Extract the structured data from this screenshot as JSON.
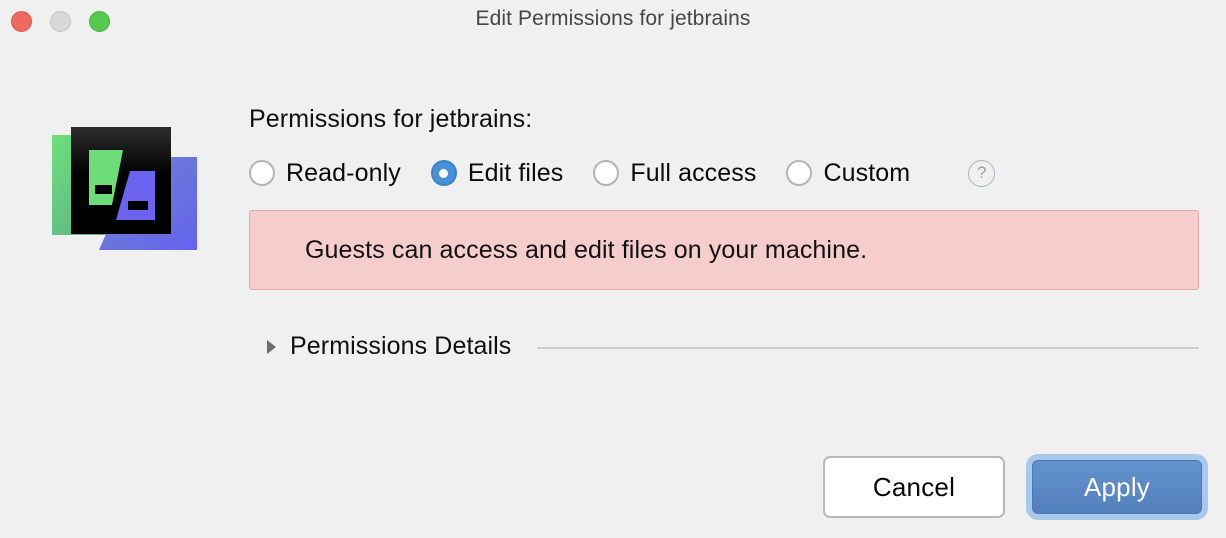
{
  "window": {
    "title": "Edit Permissions for jetbrains",
    "background_color": "#f0f0f0",
    "traffic_lights": [
      {
        "name": "close",
        "color": "#ec6a5e"
      },
      {
        "name": "minimize",
        "color": "#d8d8d8"
      },
      {
        "name": "zoom",
        "color": "#56c84e"
      }
    ]
  },
  "app_icon": {
    "name": "jetbrains-app-icon",
    "colors": {
      "green": "#6ddd79",
      "blue": "#6b63f0",
      "black": "#0a0a0a",
      "green_plate_start": "#6ee07a",
      "green_plate_end": "#5aa98a",
      "blue_plate_start": "#6f85c9",
      "blue_plate_end": "#6463ef"
    }
  },
  "main": {
    "heading": "Permissions for jetbrains:",
    "permission_options": [
      {
        "id": "read-only",
        "label": "Read-only",
        "selected": false
      },
      {
        "id": "edit-files",
        "label": "Edit files",
        "selected": true
      },
      {
        "id": "full-access",
        "label": "Full access",
        "selected": false
      },
      {
        "id": "custom",
        "label": "Custom",
        "selected": false
      }
    ],
    "selected_option": "Edit files",
    "help_button_label": "?",
    "warning": {
      "text": "Guests can access and edit files on your machine.",
      "background_color": "#f6cdcd",
      "border_color": "#deaaaa"
    },
    "disclosure": {
      "label": "Permissions Details",
      "expanded": false
    }
  },
  "footer": {
    "cancel_label": "Cancel",
    "apply_label": "Apply",
    "apply_is_default": true,
    "accent_color": "#5481bd",
    "focus_ring_color": "#a9c9ec"
  }
}
